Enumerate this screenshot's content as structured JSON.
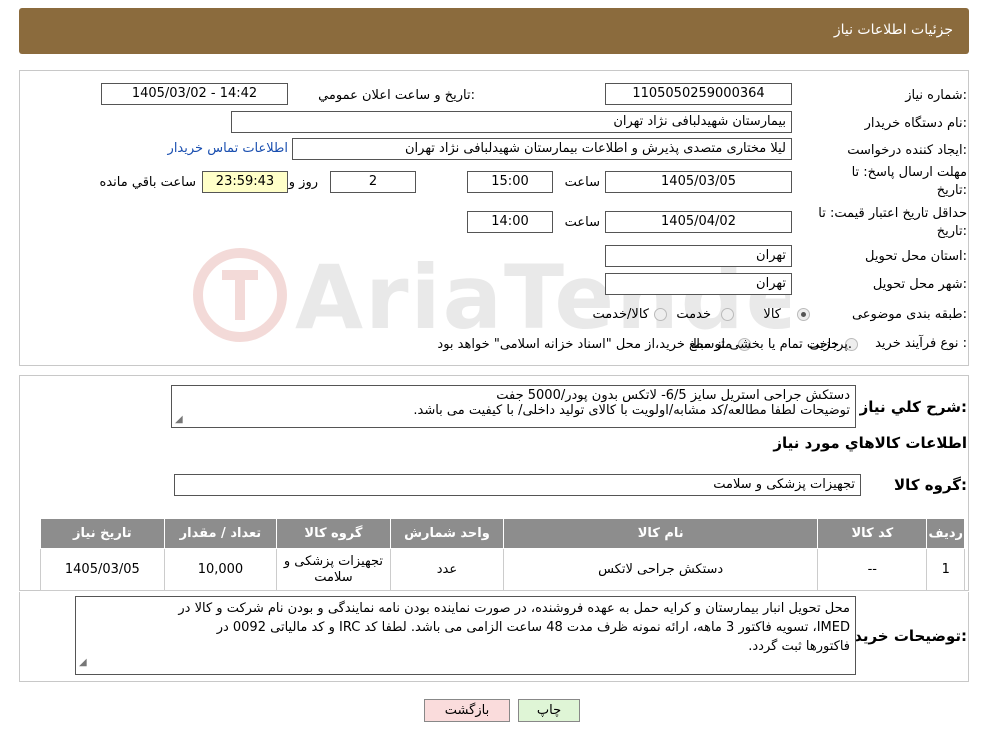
{
  "header": {
    "title": "جزئیات اطلاعات نیاز"
  },
  "form": {
    "need_number_label": "شماره نیاز:",
    "need_number": "1105050259000364",
    "announce_label": "تاریخ و ساعت اعلان عمومي:",
    "announce_value": "1405/03/02 - 14:42",
    "buyer_org_label": "نام دستگاه خریدار:",
    "buyer_org": "بیمارستان شهیدلبافی نژاد تهران",
    "creator_label": "ایجاد کننده درخواست:",
    "creator": "لیلا مختاری متصدی پذیرش و اطلاعات بیمارستان شهیدلبافی نژاد تهران",
    "contact_link": "اطلاعات تماس خریدار",
    "deadline_label_1": "مهلت ارسال پاسخ: تا",
    "deadline_label_2": "تاریخ:",
    "deadline_date": "1405/03/05",
    "time_label": "ساعت",
    "deadline_time": "15:00",
    "days_value": "2",
    "days_label": "روز و",
    "remaining_value": "23:59:43",
    "remaining_label": "ساعت باقي مانده",
    "validity_label_1": "حداقل تاریخ اعتبار قیمت: تا",
    "validity_label_2": "تاریخ:",
    "validity_date": "1405/04/02",
    "validity_time": "14:00",
    "province_label": "استان محل تحویل:",
    "province": "تهران",
    "city_label": "شهر محل تحویل:",
    "city": "تهران",
    "category_label": "طبقه بندی موضوعی:",
    "category_options": [
      "کالا",
      "خدمت",
      "کالا/خدمت"
    ],
    "process_label": "نوع فرآیند خرید :",
    "process_options": [
      "جزیی",
      "متوسط"
    ],
    "process_note": "پرداخت تمام یا بخشی از مبلغ خرید،از محل \"اسناد خزانه اسلامی\" خواهد بود."
  },
  "summary": {
    "label": "شرح كلي نياز:",
    "line1": "دستکش جراحی استریل سایز 6/5- لاتکس بدون پودر/5000 جفت",
    "line2": "توضیحات لطفا مطالعه/کد مشابه/اولویت با کالای تولید داخلی/ با کیفیت می باشد.",
    "goods_info_title": "اطلاعات كالاهاي مورد نياز",
    "group_label": "گروه كالا:",
    "group_value": "تجهیزات پزشکی و سلامت"
  },
  "table": {
    "headers": [
      "رديف",
      "كد كالا",
      "نام كالا",
      "واحد شمارش",
      "گروه كالا",
      "تعداد / مقدار",
      "تاريخ نياز"
    ],
    "rows": [
      [
        "1",
        "--",
        "دستکش جراحی لاتکس",
        "عدد",
        "تجهیزات پزشکی و سلامت",
        "10,000",
        "1405/03/05"
      ]
    ]
  },
  "buyer_notes": {
    "label": "توضیحات خریدار:",
    "line1": "محل تحویل انبار بیمارستان و کرایه حمل به عهده فروشنده، در صورت نماینده بودن نامه نمایندگی و بودن نام شرکت و کالا در",
    "line2": "IMED، تسویه فاکتور 3 ماهه، ارائه نمونه ظرف مدت 48 ساعت الزامی می باشد. لطفا کد IRC و کد مالیاتی 0092 در",
    "line3": "فاکتورها ثبت گردد."
  },
  "buttons": {
    "print": "چاپ",
    "back": "بازگشت"
  },
  "colors": {
    "header": "#8b6b3d",
    "print_btn": "#dff5d6",
    "back_btn": "#fadcdc"
  }
}
